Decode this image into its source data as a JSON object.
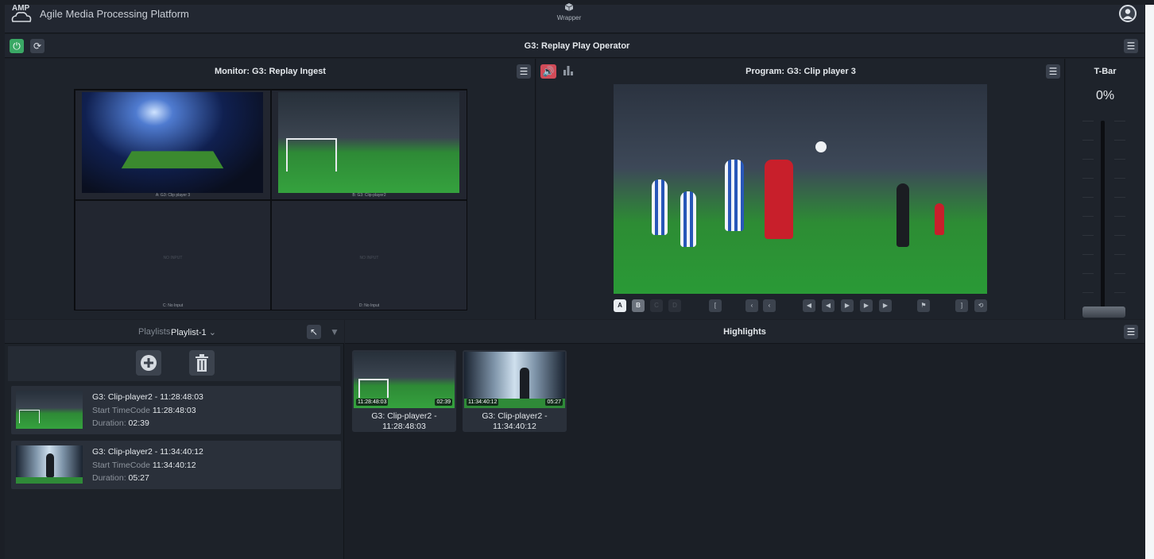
{
  "app": {
    "title": "Agile Media Processing Platform",
    "logo_text": "AMP"
  },
  "nav": {
    "wrapper_label": "Wrapper"
  },
  "operator": {
    "title": "G3: Replay Play Operator"
  },
  "monitor": {
    "title": "Monitor: G3: Replay Ingest",
    "cells": [
      {
        "label": "A: G3: Clip player 3",
        "status": ""
      },
      {
        "label": "B: G3: Clip-player2",
        "status": ""
      },
      {
        "label": "C: No Input",
        "status": "NO INPUT"
      },
      {
        "label": "D: No Input",
        "status": "NO INPUT"
      }
    ]
  },
  "program": {
    "title": "Program: G3: Clip player 3",
    "buses": [
      "A",
      "B",
      "C",
      "D"
    ]
  },
  "tbar": {
    "title": "T-Bar",
    "value": "0%",
    "level": 0
  },
  "playlists": {
    "label": "Playlists",
    "selected": "Playlist-1",
    "items": [
      {
        "title": "G3: Clip-player2 - 11:28:48:03",
        "start_label": "Start TimeCode",
        "start_value": "11:28:48:03",
        "duration_label": "Duration:",
        "duration_value": "02:39"
      },
      {
        "title": "G3: Clip-player2 - 11:34:40:12",
        "start_label": "Start TimeCode",
        "start_value": "11:34:40:12",
        "duration_label": "Duration:",
        "duration_value": "05:27"
      }
    ]
  },
  "highlights": {
    "title": "Highlights",
    "clips": [
      {
        "timecode": "11:28:48:03",
        "duration": "02:39",
        "name_line1": "G3: Clip-player2 -",
        "name_line2": "11:28:48:03"
      },
      {
        "timecode": "11:34:40:12",
        "duration": "05:27",
        "name_line1": "G3: Clip-player2 -",
        "name_line2": "11:34:40:12"
      }
    ]
  },
  "icons": {
    "power": "power-icon",
    "refresh": "refresh-icon",
    "menu": "hamburger-menu-icon",
    "audio": "speaker-icon",
    "meter": "audio-meter-icon",
    "add": "plus-circle-icon",
    "delete": "trash-icon",
    "user": "user-avatar-icon",
    "wrapper": "cube-icon"
  },
  "colors": {
    "accent_green": "#3aa865",
    "audio_red": "#d14b58",
    "background": "#1b1f26"
  }
}
